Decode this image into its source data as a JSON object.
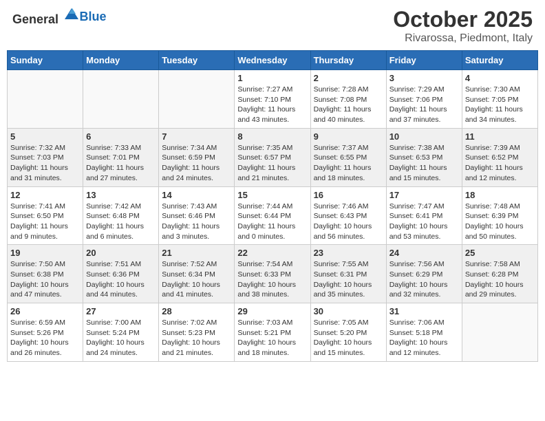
{
  "logo": {
    "general": "General",
    "blue": "Blue"
  },
  "title": {
    "month_year": "October 2025",
    "location": "Rivarossa, Piedmont, Italy"
  },
  "weekdays": [
    "Sunday",
    "Monday",
    "Tuesday",
    "Wednesday",
    "Thursday",
    "Friday",
    "Saturday"
  ],
  "weeks": [
    [
      {
        "day": "",
        "info": ""
      },
      {
        "day": "",
        "info": ""
      },
      {
        "day": "",
        "info": ""
      },
      {
        "day": "1",
        "info": "Sunrise: 7:27 AM\nSunset: 7:10 PM\nDaylight: 11 hours\nand 43 minutes."
      },
      {
        "day": "2",
        "info": "Sunrise: 7:28 AM\nSunset: 7:08 PM\nDaylight: 11 hours\nand 40 minutes."
      },
      {
        "day": "3",
        "info": "Sunrise: 7:29 AM\nSunset: 7:06 PM\nDaylight: 11 hours\nand 37 minutes."
      },
      {
        "day": "4",
        "info": "Sunrise: 7:30 AM\nSunset: 7:05 PM\nDaylight: 11 hours\nand 34 minutes."
      }
    ],
    [
      {
        "day": "5",
        "info": "Sunrise: 7:32 AM\nSunset: 7:03 PM\nDaylight: 11 hours\nand 31 minutes."
      },
      {
        "day": "6",
        "info": "Sunrise: 7:33 AM\nSunset: 7:01 PM\nDaylight: 11 hours\nand 27 minutes."
      },
      {
        "day": "7",
        "info": "Sunrise: 7:34 AM\nSunset: 6:59 PM\nDaylight: 11 hours\nand 24 minutes."
      },
      {
        "day": "8",
        "info": "Sunrise: 7:35 AM\nSunset: 6:57 PM\nDaylight: 11 hours\nand 21 minutes."
      },
      {
        "day": "9",
        "info": "Sunrise: 7:37 AM\nSunset: 6:55 PM\nDaylight: 11 hours\nand 18 minutes."
      },
      {
        "day": "10",
        "info": "Sunrise: 7:38 AM\nSunset: 6:53 PM\nDaylight: 11 hours\nand 15 minutes."
      },
      {
        "day": "11",
        "info": "Sunrise: 7:39 AM\nSunset: 6:52 PM\nDaylight: 11 hours\nand 12 minutes."
      }
    ],
    [
      {
        "day": "12",
        "info": "Sunrise: 7:41 AM\nSunset: 6:50 PM\nDaylight: 11 hours\nand 9 minutes."
      },
      {
        "day": "13",
        "info": "Sunrise: 7:42 AM\nSunset: 6:48 PM\nDaylight: 11 hours\nand 6 minutes."
      },
      {
        "day": "14",
        "info": "Sunrise: 7:43 AM\nSunset: 6:46 PM\nDaylight: 11 hours\nand 3 minutes."
      },
      {
        "day": "15",
        "info": "Sunrise: 7:44 AM\nSunset: 6:44 PM\nDaylight: 11 hours\nand 0 minutes."
      },
      {
        "day": "16",
        "info": "Sunrise: 7:46 AM\nSunset: 6:43 PM\nDaylight: 10 hours\nand 56 minutes."
      },
      {
        "day": "17",
        "info": "Sunrise: 7:47 AM\nSunset: 6:41 PM\nDaylight: 10 hours\nand 53 minutes."
      },
      {
        "day": "18",
        "info": "Sunrise: 7:48 AM\nSunset: 6:39 PM\nDaylight: 10 hours\nand 50 minutes."
      }
    ],
    [
      {
        "day": "19",
        "info": "Sunrise: 7:50 AM\nSunset: 6:38 PM\nDaylight: 10 hours\nand 47 minutes."
      },
      {
        "day": "20",
        "info": "Sunrise: 7:51 AM\nSunset: 6:36 PM\nDaylight: 10 hours\nand 44 minutes."
      },
      {
        "day": "21",
        "info": "Sunrise: 7:52 AM\nSunset: 6:34 PM\nDaylight: 10 hours\nand 41 minutes."
      },
      {
        "day": "22",
        "info": "Sunrise: 7:54 AM\nSunset: 6:33 PM\nDaylight: 10 hours\nand 38 minutes."
      },
      {
        "day": "23",
        "info": "Sunrise: 7:55 AM\nSunset: 6:31 PM\nDaylight: 10 hours\nand 35 minutes."
      },
      {
        "day": "24",
        "info": "Sunrise: 7:56 AM\nSunset: 6:29 PM\nDaylight: 10 hours\nand 32 minutes."
      },
      {
        "day": "25",
        "info": "Sunrise: 7:58 AM\nSunset: 6:28 PM\nDaylight: 10 hours\nand 29 minutes."
      }
    ],
    [
      {
        "day": "26",
        "info": "Sunrise: 6:59 AM\nSunset: 5:26 PM\nDaylight: 10 hours\nand 26 minutes."
      },
      {
        "day": "27",
        "info": "Sunrise: 7:00 AM\nSunset: 5:24 PM\nDaylight: 10 hours\nand 24 minutes."
      },
      {
        "day": "28",
        "info": "Sunrise: 7:02 AM\nSunset: 5:23 PM\nDaylight: 10 hours\nand 21 minutes."
      },
      {
        "day": "29",
        "info": "Sunrise: 7:03 AM\nSunset: 5:21 PM\nDaylight: 10 hours\nand 18 minutes."
      },
      {
        "day": "30",
        "info": "Sunrise: 7:05 AM\nSunset: 5:20 PM\nDaylight: 10 hours\nand 15 minutes."
      },
      {
        "day": "31",
        "info": "Sunrise: 7:06 AM\nSunset: 5:18 PM\nDaylight: 10 hours\nand 12 minutes."
      },
      {
        "day": "",
        "info": ""
      }
    ]
  ]
}
